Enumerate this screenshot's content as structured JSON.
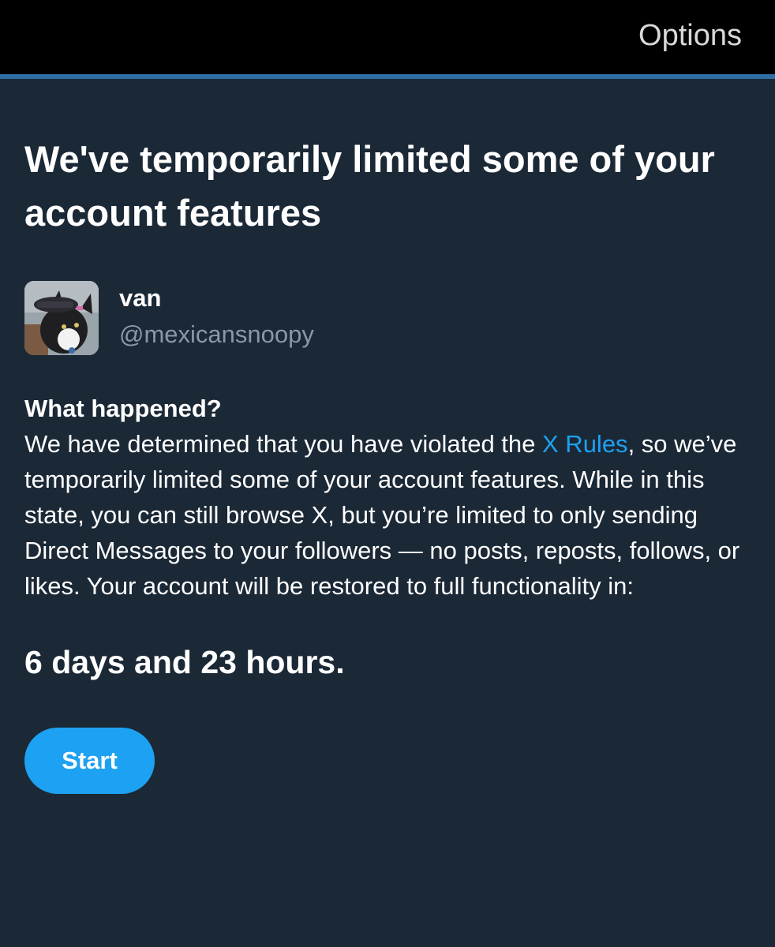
{
  "header": {
    "options_label": "Options"
  },
  "main": {
    "headline": "We've temporarily limited some of your account features",
    "user": {
      "name": "van",
      "handle": "@mexicansnoopy",
      "avatar_icon": "avatar-cat-photo"
    },
    "section_title": "What happened?",
    "body": {
      "text_before_link": "We have determined that you have violated the ",
      "link_label": "X Rules",
      "text_after_link": ", so we’ve temporarily limited some of your account features. While in this state, you can still browse X, but you’re limited to only sending Direct Messages to your followers — no posts, reposts, follows, or likes. Your account will be restored to full functionality in:"
    },
    "countdown": "6 days and 23 hours.",
    "start_button_label": "Start"
  },
  "colors": {
    "background": "#1b2836",
    "header_background": "#000000",
    "accent_line": "#2f6ea5",
    "link": "#1da1f2",
    "button": "#1da1f2",
    "muted_text": "#8899a6"
  }
}
